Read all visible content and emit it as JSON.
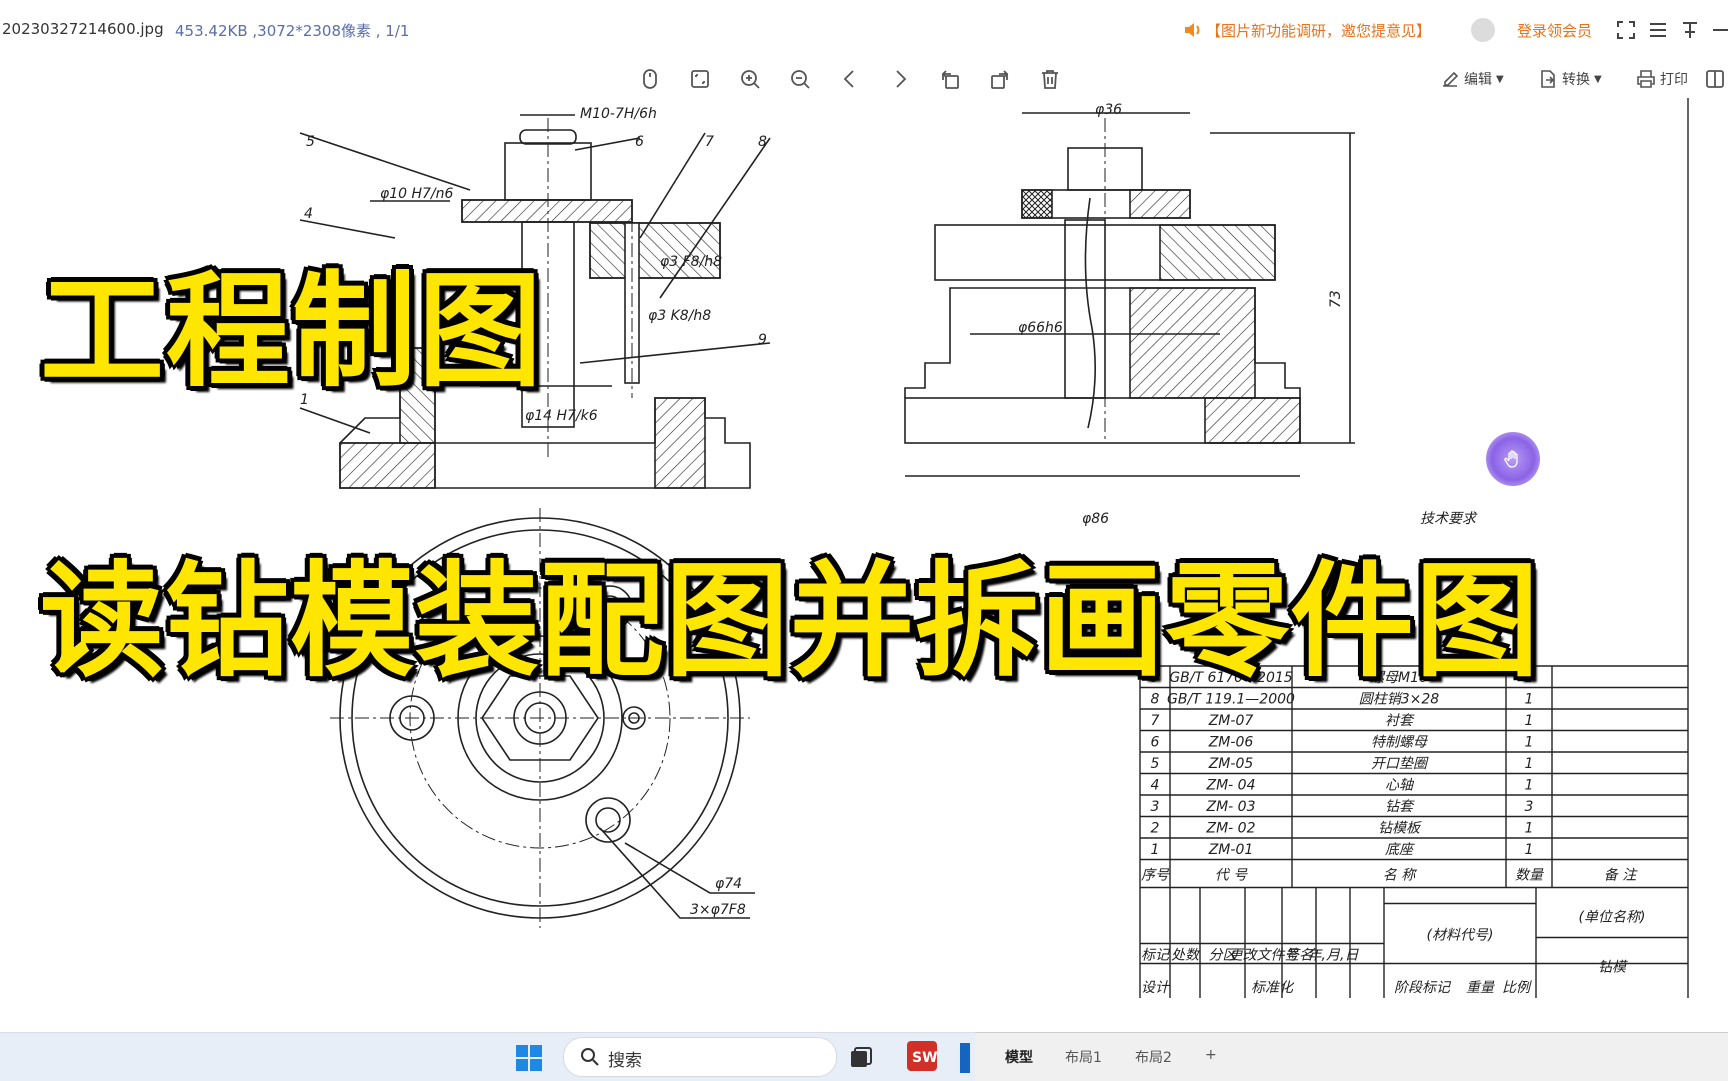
{
  "titlebar": {
    "filename": "20230327214600.jpg",
    "fileinfo": "453.42KB ,3072*2308像素 , 1/1",
    "notice": "【图片新功能调研，邀您提意见】",
    "login": "登录领会员"
  },
  "toolbar": {
    "edit": "编辑",
    "convert": "转换",
    "print": "打印"
  },
  "overlay": {
    "line1": "工程制图",
    "line2": "读钻模装配图并拆画零件图"
  },
  "drawing": {
    "labels": {
      "thread": "M10-7H/6h",
      "phi36": "φ36",
      "phi10": "φ10 H7/n6",
      "phi3a": "φ3 F8/h8",
      "phi3b": "φ3 K8/h8",
      "phi14": "φ14 H7/k6",
      "phi66": "φ66h6",
      "h73": "73",
      "phi86": "φ86",
      "phi74": "φ74",
      "holes": "3×φ7F8",
      "n1": "1",
      "n4": "4",
      "n5": "5",
      "n6": "6",
      "n7": "7",
      "n8": "8",
      "n9": "9",
      "tech": "技术要求"
    },
    "bom": [
      {
        "no": "9",
        "code": "GB/T 6170—2015",
        "name": "螺母M10",
        "qty": "1"
      },
      {
        "no": "8",
        "code": "GB/T 119.1—2000",
        "name": "圆柱销3×28",
        "qty": "1"
      },
      {
        "no": "7",
        "code": "ZM-07",
        "name": "衬套",
        "qty": "1"
      },
      {
        "no": "6",
        "code": "ZM-06",
        "name": "特制螺母",
        "qty": "1"
      },
      {
        "no": "5",
        "code": "ZM-05",
        "name": "开口垫圈",
        "qty": "1"
      },
      {
        "no": "4",
        "code": "ZM- 04",
        "name": "心轴",
        "qty": "1"
      },
      {
        "no": "3",
        "code": "ZM- 03",
        "name": "钻套",
        "qty": "3"
      },
      {
        "no": "2",
        "code": "ZM- 02",
        "name": "钻模板",
        "qty": "1"
      },
      {
        "no": "1",
        "code": "ZM-01",
        "name": "底座",
        "qty": "1"
      }
    ],
    "bom_header": {
      "no": "序号",
      "code": "代  号",
      "name": "名  称",
      "qty": "数量",
      "note": "备  注"
    },
    "titleblock": {
      "material": "(材料代号)",
      "unit": "(单位名称)",
      "partname": "钻模",
      "marks": [
        "标记",
        "处数",
        "分区",
        "更改文件号",
        "签名",
        "年,月,日"
      ],
      "design": "设计",
      "standard": "标准化",
      "stage": "阶段标记",
      "weight": "重量",
      "scale": "比例"
    }
  },
  "taskbar": {
    "search": "搜索"
  },
  "cad": {
    "tabs": [
      "模型",
      "布局1",
      "布局2",
      "+"
    ]
  }
}
